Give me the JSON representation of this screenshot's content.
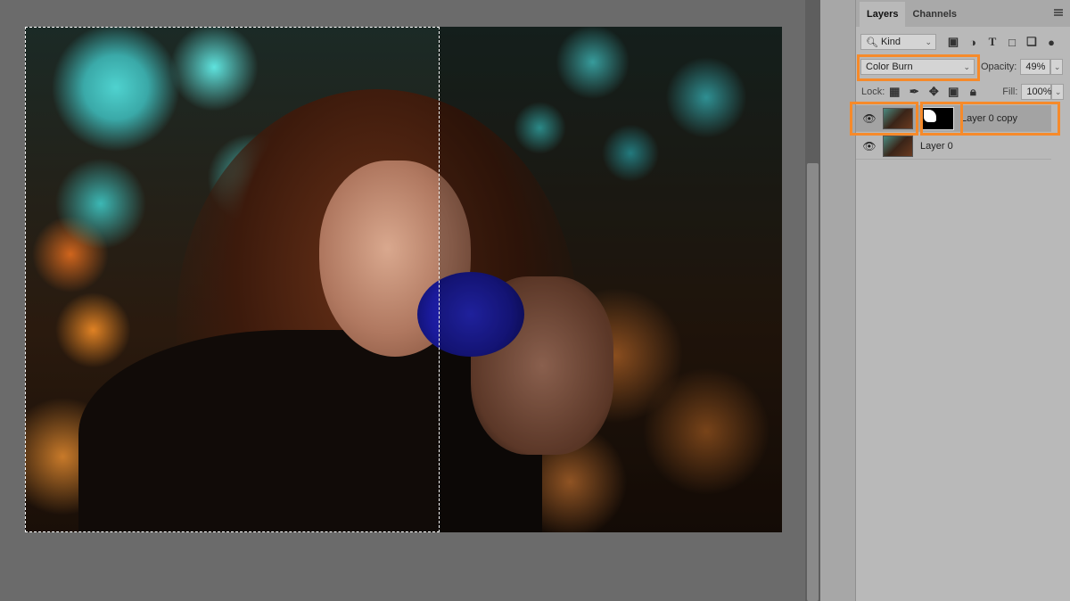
{
  "panel": {
    "tabs": [
      {
        "label": "Layers",
        "active": true
      },
      {
        "label": "Channels",
        "active": false
      }
    ],
    "filter": {
      "label": "Kind",
      "icons": [
        "image-filter-icon",
        "adjustment-filter-icon",
        "type-filter-icon",
        "shape-filter-icon",
        "smart-object-filter-icon"
      ]
    },
    "blend_mode": "Color Burn",
    "opacity_label": "Opacity:",
    "opacity": "49%",
    "lock_label": "Lock:",
    "fill_label": "Fill:",
    "fill": "100%",
    "layers": [
      {
        "name": "Layer 0 copy",
        "visible": true,
        "selected": true,
        "has_mask": true
      },
      {
        "name": "Layer 0",
        "visible": true,
        "selected": false,
        "has_mask": false
      }
    ]
  },
  "colors": {
    "highlight": "#f68a2a",
    "panel_bg": "#b9b9b9",
    "canvas_bg": "#6b6b6b"
  }
}
